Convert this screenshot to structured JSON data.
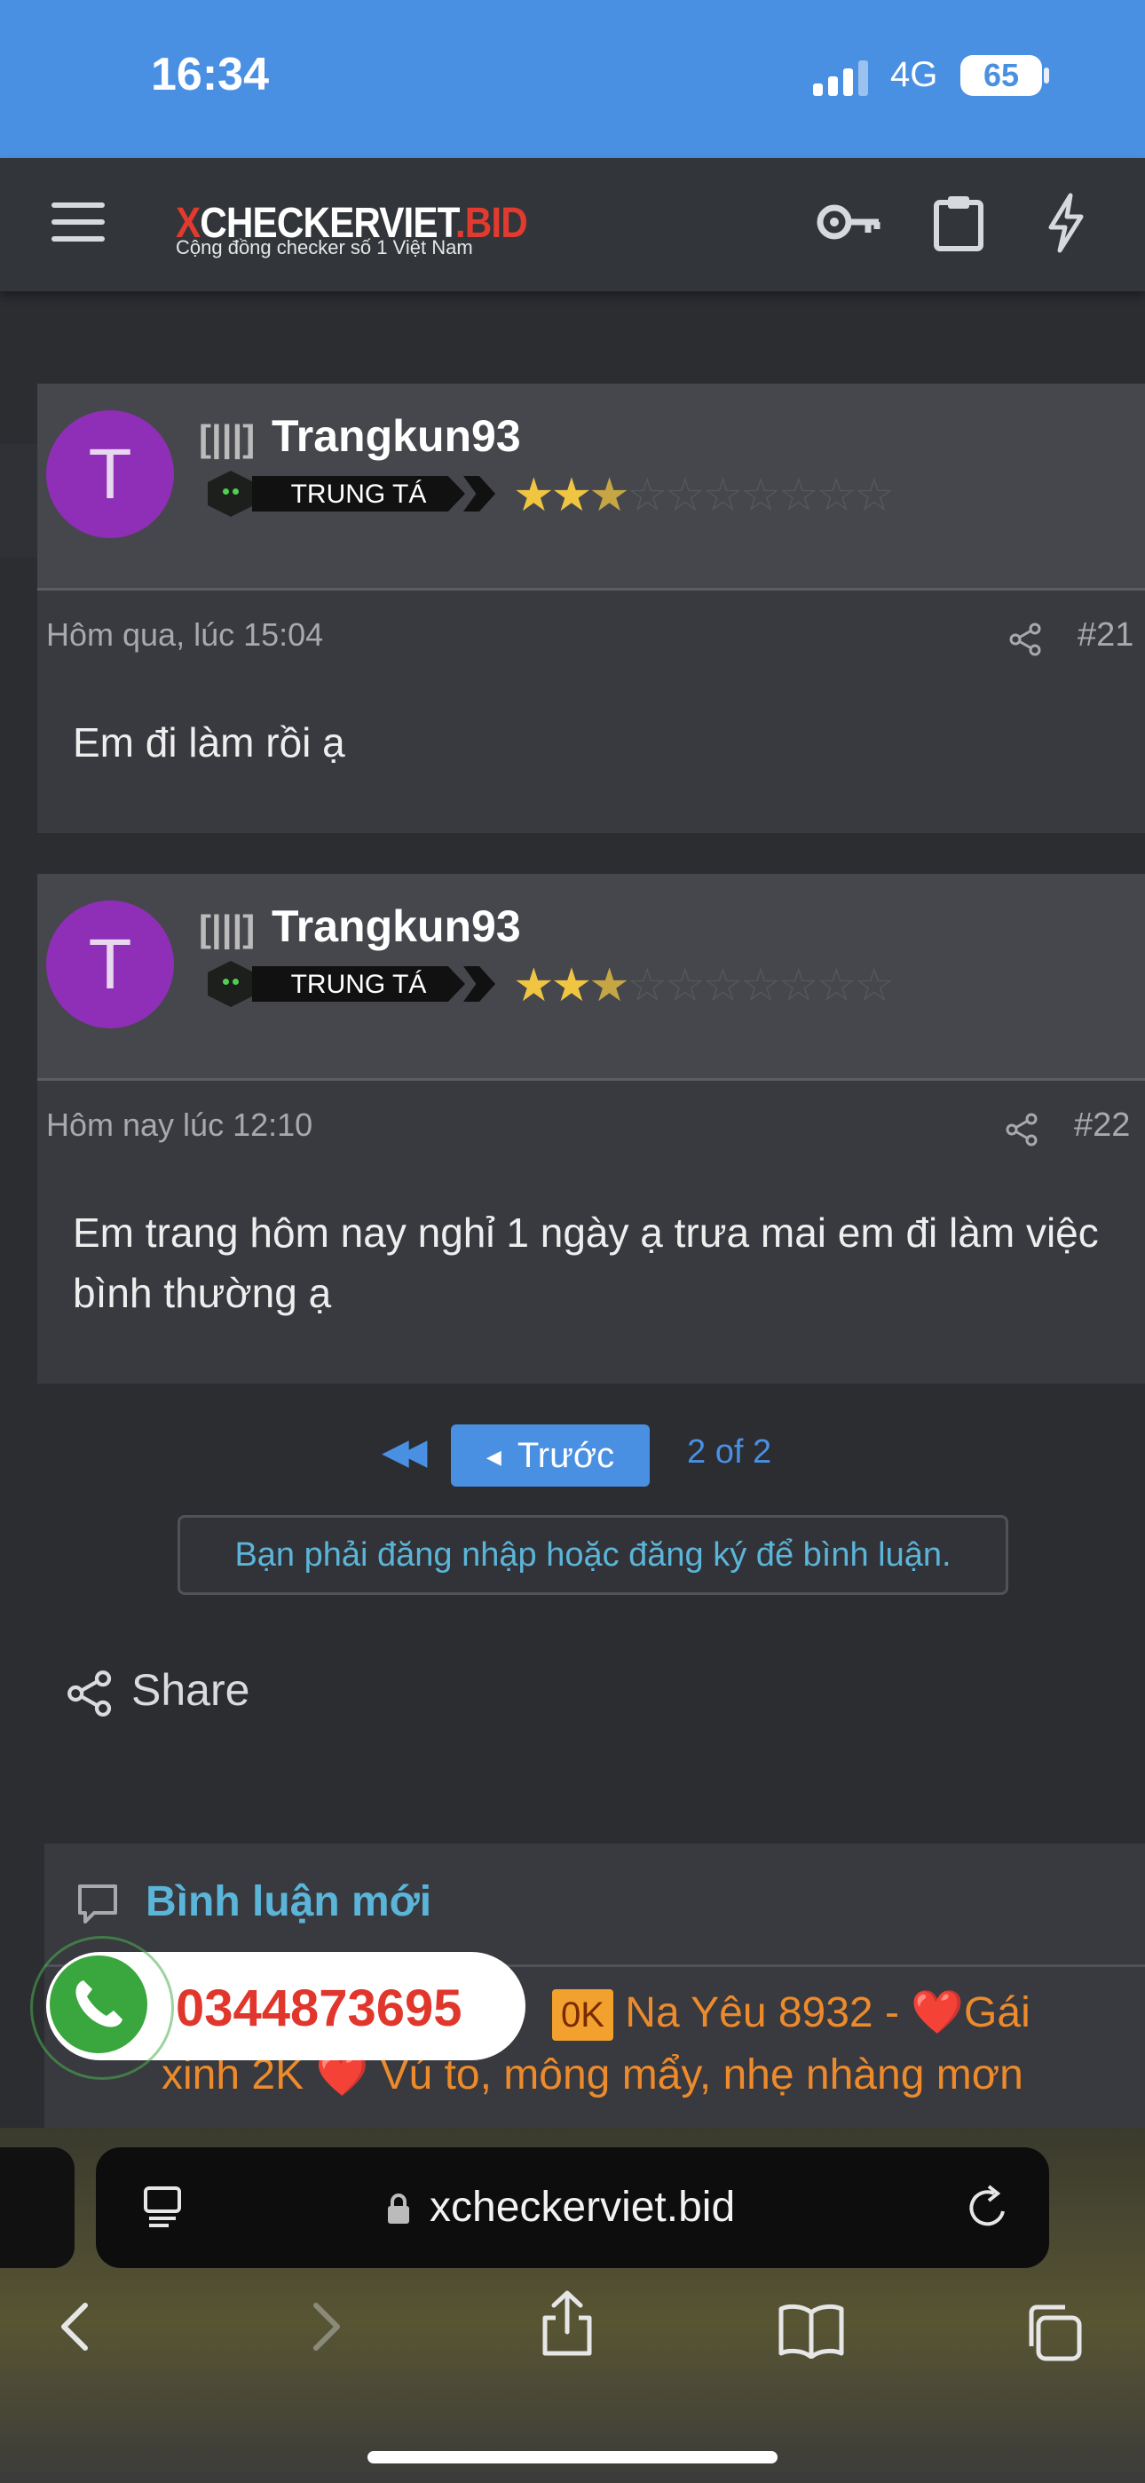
{
  "status_bar": {
    "time": "16:34",
    "network": "4G",
    "battery": "65"
  },
  "header": {
    "logo": "XCHECKERVIET.BID",
    "logo_prefix": "X",
    "logo_mid": "CHECKERVIET",
    "logo_suffix": ".BID",
    "tagline": "Cộng đồng checker số 1 Việt Nam"
  },
  "posts": [
    {
      "avatar_letter": "T",
      "username": "Trangkun93",
      "rank": "TRUNG TÁ",
      "stars": 2.5,
      "stars_total": 10,
      "timestamp": "Hôm qua, lúc 15:04",
      "number": "#21",
      "body": "Em đi làm rồi ạ"
    },
    {
      "avatar_letter": "T",
      "username": "Trangkun93",
      "rank": "TRUNG TÁ",
      "stars": 2.5,
      "stars_total": 10,
      "timestamp": "Hôm nay lúc 12:10",
      "number": "#22",
      "body": "Em trang hôm nay nghỉ 1 ngày ạ trưa mai em đi làm việc bình thường ạ"
    }
  ],
  "pagination": {
    "prev_label": "Trước",
    "page_of": "2 of 2"
  },
  "login_note": "Bạn phải đăng nhập hoặc đăng ký để bình luận.",
  "share_label": "Share",
  "new_comments": {
    "title": "Bình luận mới",
    "tag": "0K",
    "line1_text": " Na Yêu 8932 - ",
    "line1_tail": "Gái",
    "line2": "xinh 2K ❤️ Vú to, mông mẩy, nhẹ nhàng mơn"
  },
  "phone": {
    "number": "0344873695"
  },
  "browser": {
    "url": "xcheckerviet.bid"
  },
  "colors": {
    "accent": "#4a90e2",
    "status_blue": "#4a90e2",
    "avatar": "#8f2fb7",
    "phone_red": "#e0362c"
  }
}
